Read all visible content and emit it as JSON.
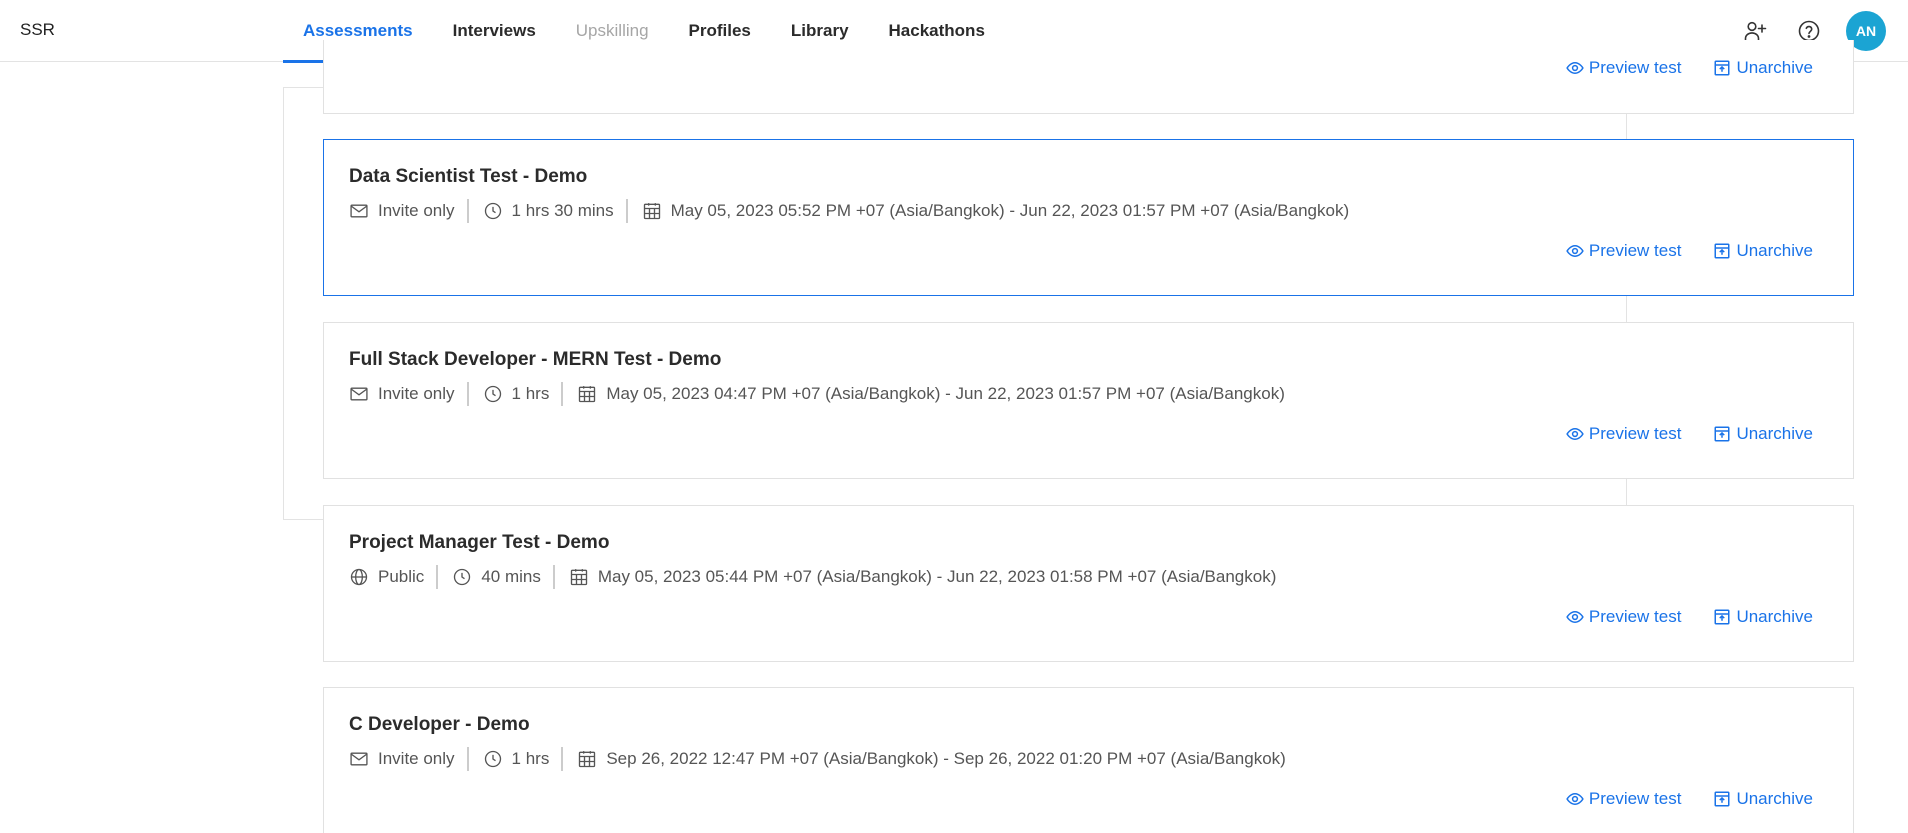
{
  "header": {
    "brand": "SSR",
    "nav": [
      {
        "label": "Assessments"
      },
      {
        "label": "Interviews"
      },
      {
        "label": "Upskilling"
      },
      {
        "label": "Profiles"
      },
      {
        "label": "Library"
      },
      {
        "label": "Hackathons"
      }
    ],
    "avatar_initials": "AN",
    "icons": [
      "add-user-icon",
      "help-icon"
    ]
  },
  "partial_card": {
    "preview_label": "Preview test",
    "unarchive_label": "Unarchive"
  },
  "tests": [
    {
      "title": "Data Scientist Test - Demo",
      "access": "Invite only",
      "access_icon": "mail-icon",
      "duration": "1 hrs 30 mins",
      "schedule": "May 05, 2023 05:52 PM +07 (Asia/Bangkok) - Jun 22, 2023 01:57 PM +07 (Asia/Bangkok)",
      "preview_label": "Preview test",
      "unarchive_label": "Unarchive"
    },
    {
      "title": "Full Stack Developer - MERN Test - Demo",
      "access": "Invite only",
      "access_icon": "mail-icon",
      "duration": "1 hrs",
      "schedule": "May 05, 2023 04:47 PM +07 (Asia/Bangkok) - Jun 22, 2023 01:57 PM +07 (Asia/Bangkok)",
      "preview_label": "Preview test",
      "unarchive_label": "Unarchive"
    },
    {
      "title": "Project Manager Test - Demo",
      "access": "Public",
      "access_icon": "globe-icon",
      "duration": "40 mins",
      "schedule": "May 05, 2023 05:44 PM +07 (Asia/Bangkok) - Jun 22, 2023 01:58 PM +07 (Asia/Bangkok)",
      "preview_label": "Preview test",
      "unarchive_label": "Unarchive"
    },
    {
      "title": "C Developer - Demo",
      "access": "Invite only",
      "access_icon": "mail-icon",
      "duration": "1 hrs",
      "schedule": "Sep 26, 2022 12:47 PM +07 (Asia/Bangkok) - Sep 26, 2022 01:20 PM +07 (Asia/Bangkok)",
      "preview_label": "Preview test",
      "unarchive_label": "Unarchive"
    }
  ],
  "colors": {
    "accent": "#1a73e8",
    "avatar": "#1ba4d3",
    "border": "#e1e1e1"
  }
}
